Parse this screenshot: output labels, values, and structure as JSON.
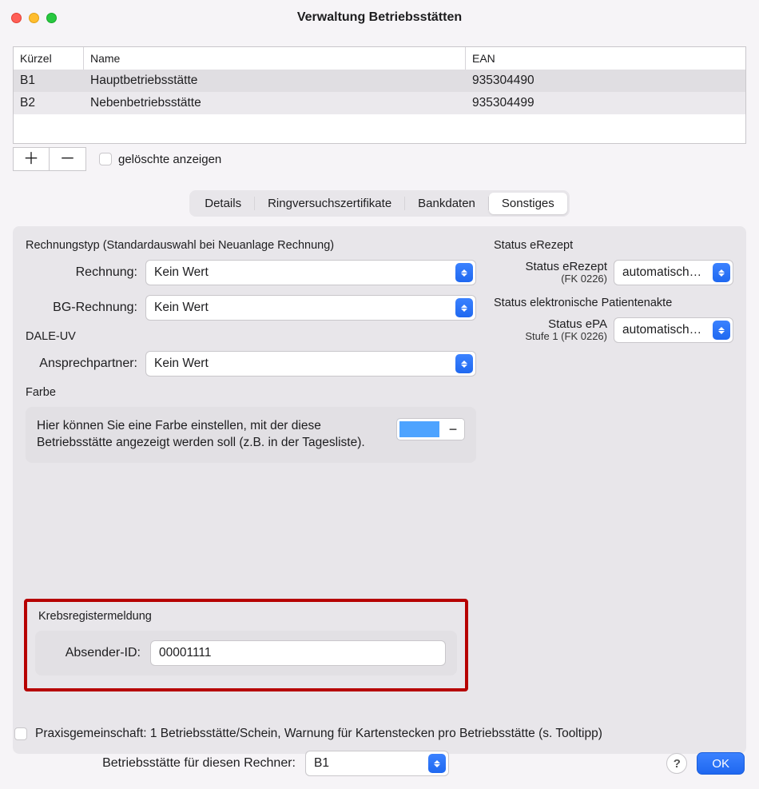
{
  "window": {
    "title": "Verwaltung Betriebsstätten"
  },
  "table": {
    "columns": {
      "code": "Kürzel",
      "name": "Name",
      "ean": "EAN"
    },
    "rows": [
      {
        "code": "B1",
        "name": "Hauptbetriebsstätte",
        "ean": "935304490"
      },
      {
        "code": "B2",
        "name": "Nebenbetriebsstätte",
        "ean": "935304499"
      }
    ],
    "add_glyph": "＋",
    "remove_glyph": "－",
    "show_deleted_label": "gelöschte anzeigen"
  },
  "tabs": {
    "details": "Details",
    "ring": "Ringversuchszertifikate",
    "bank": "Bankdaten",
    "sonst": "Sonstiges"
  },
  "left": {
    "rechnungstyp_title": "Rechnungstyp (Standardauswahl bei Neuanlage Rechnung)",
    "rechnung_label": "Rechnung:",
    "rechnung_value": "Kein Wert",
    "bg_label": "BG-Rechnung:",
    "bg_value": "Kein Wert",
    "dale_title": "DALE-UV",
    "ansprech_label": "Ansprechpartner:",
    "ansprech_value": "Kein Wert",
    "farbe_title": "Farbe",
    "farbe_text": "Hier können Sie eine Farbe einstellen, mit der diese Betriebsstätte angezeigt werden soll (z.B. in der Tagesliste).",
    "farbe_clear": "−",
    "farbe_color": "#4da3ff"
  },
  "right": {
    "erezept_title": "Status eRezept",
    "erezept_label": "Status eRezept",
    "erezept_sub": "(FK 0226)",
    "erezept_value": "automatisch…",
    "epa_title": "Status elektronische Patientenakte",
    "epa_label": "Status ePA",
    "epa_sub": "Stufe 1 (FK 0226)",
    "epa_value": "automatisch…"
  },
  "krebs": {
    "title": "Krebsregistermeldung",
    "label": "Absender-ID:",
    "value": "00001111"
  },
  "footer": {
    "praxis_label": "Praxisgemeinschaft: 1 Betriebsstätte/Schein, Warnung für Kartenstecken pro Betriebsstätte (s. Tooltipp)",
    "rechner_label": "Betriebsstätte für diesen Rechner:",
    "rechner_value": "B1",
    "help": "?",
    "ok": "OK"
  }
}
